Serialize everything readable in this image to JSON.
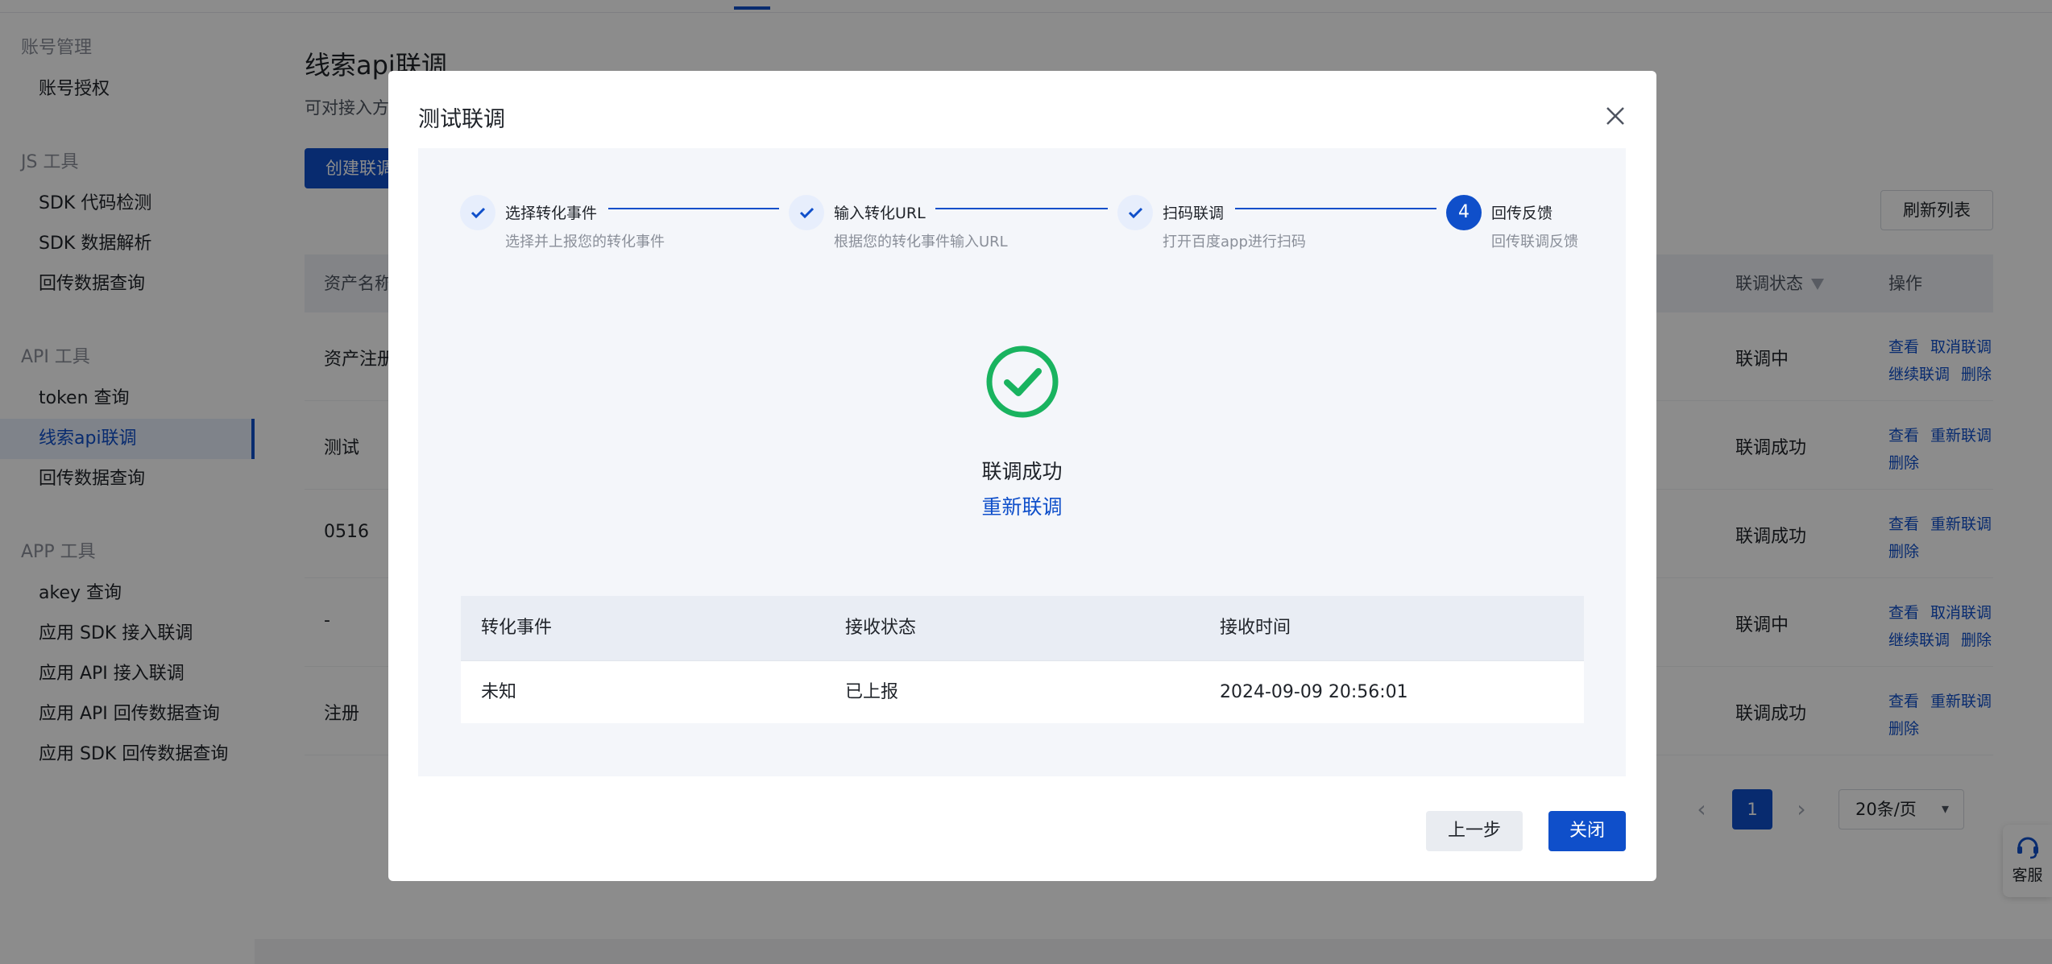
{
  "sidebar": {
    "groups": [
      {
        "label": "账号管理",
        "items": [
          "账号授权"
        ]
      },
      {
        "label": "JS 工具",
        "items": [
          "SDK 代码检测",
          "SDK 数据解析",
          "回传数据查询"
        ]
      },
      {
        "label": "API 工具",
        "items": [
          "token 查询",
          "线索api联调",
          "回传数据查询"
        ]
      },
      {
        "label": "APP 工具",
        "items": [
          "akey 查询",
          "应用 SDK 接入联调",
          "应用 API 接入联调",
          "应用 API 回传数据查询",
          "应用 SDK 回传数据查询"
        ]
      }
    ],
    "active_item": "线索api联调"
  },
  "page": {
    "title": "线索api联调",
    "description": "可对接入方",
    "create_button": "创建联调",
    "refresh_button": "刷新列表",
    "table_headers": {
      "name": "资产名称",
      "status": "联调状态",
      "actions": "操作"
    },
    "rows": [
      {
        "name": "资产注册",
        "status": "联调中",
        "actions": [
          "查看",
          "取消联调",
          "继续联调",
          "删除"
        ]
      },
      {
        "name": "测试",
        "status": "联调成功",
        "actions": [
          "查看",
          "重新联调",
          "删除"
        ]
      },
      {
        "name": "0516",
        "status": "联调成功",
        "actions": [
          "查看",
          "重新联调",
          "删除"
        ]
      },
      {
        "name": "-",
        "status": "联调中",
        "actions": [
          "查看",
          "取消联调",
          "继续联调",
          "删除"
        ]
      },
      {
        "name": "注册",
        "status": "联调成功",
        "actions": [
          "查看",
          "重新联调",
          "删除"
        ]
      }
    ],
    "pagination": {
      "prev": "‹",
      "current_page": "1",
      "next": "›",
      "page_size": "20条/页"
    },
    "support_label": "客服"
  },
  "modal": {
    "title": "测试联调",
    "steps": [
      {
        "title": "选择转化事件",
        "desc": "选择并上报您的转化事件",
        "state": "done"
      },
      {
        "title": "输入转化URL",
        "desc": "根据您的转化事件输入URL",
        "state": "done"
      },
      {
        "title": "扫码联调",
        "desc": "打开百度app进行扫码",
        "state": "done"
      },
      {
        "title": "回传反馈",
        "desc": "回传联调反馈",
        "state": "current",
        "number": "4"
      }
    ],
    "result_title": "联调成功",
    "relink_label": "重新联调",
    "result_table": {
      "headers": [
        "转化事件",
        "接收状态",
        "接收时间"
      ],
      "rows": [
        [
          "未知",
          "已上报",
          "2024-09-09 20:56:01"
        ]
      ]
    },
    "prev_button": "上一步",
    "close_button": "关闭"
  },
  "colors": {
    "primary": "#0f4fca",
    "success": "#19b35f",
    "overlay": "rgba(0,0,0,0.45)"
  }
}
